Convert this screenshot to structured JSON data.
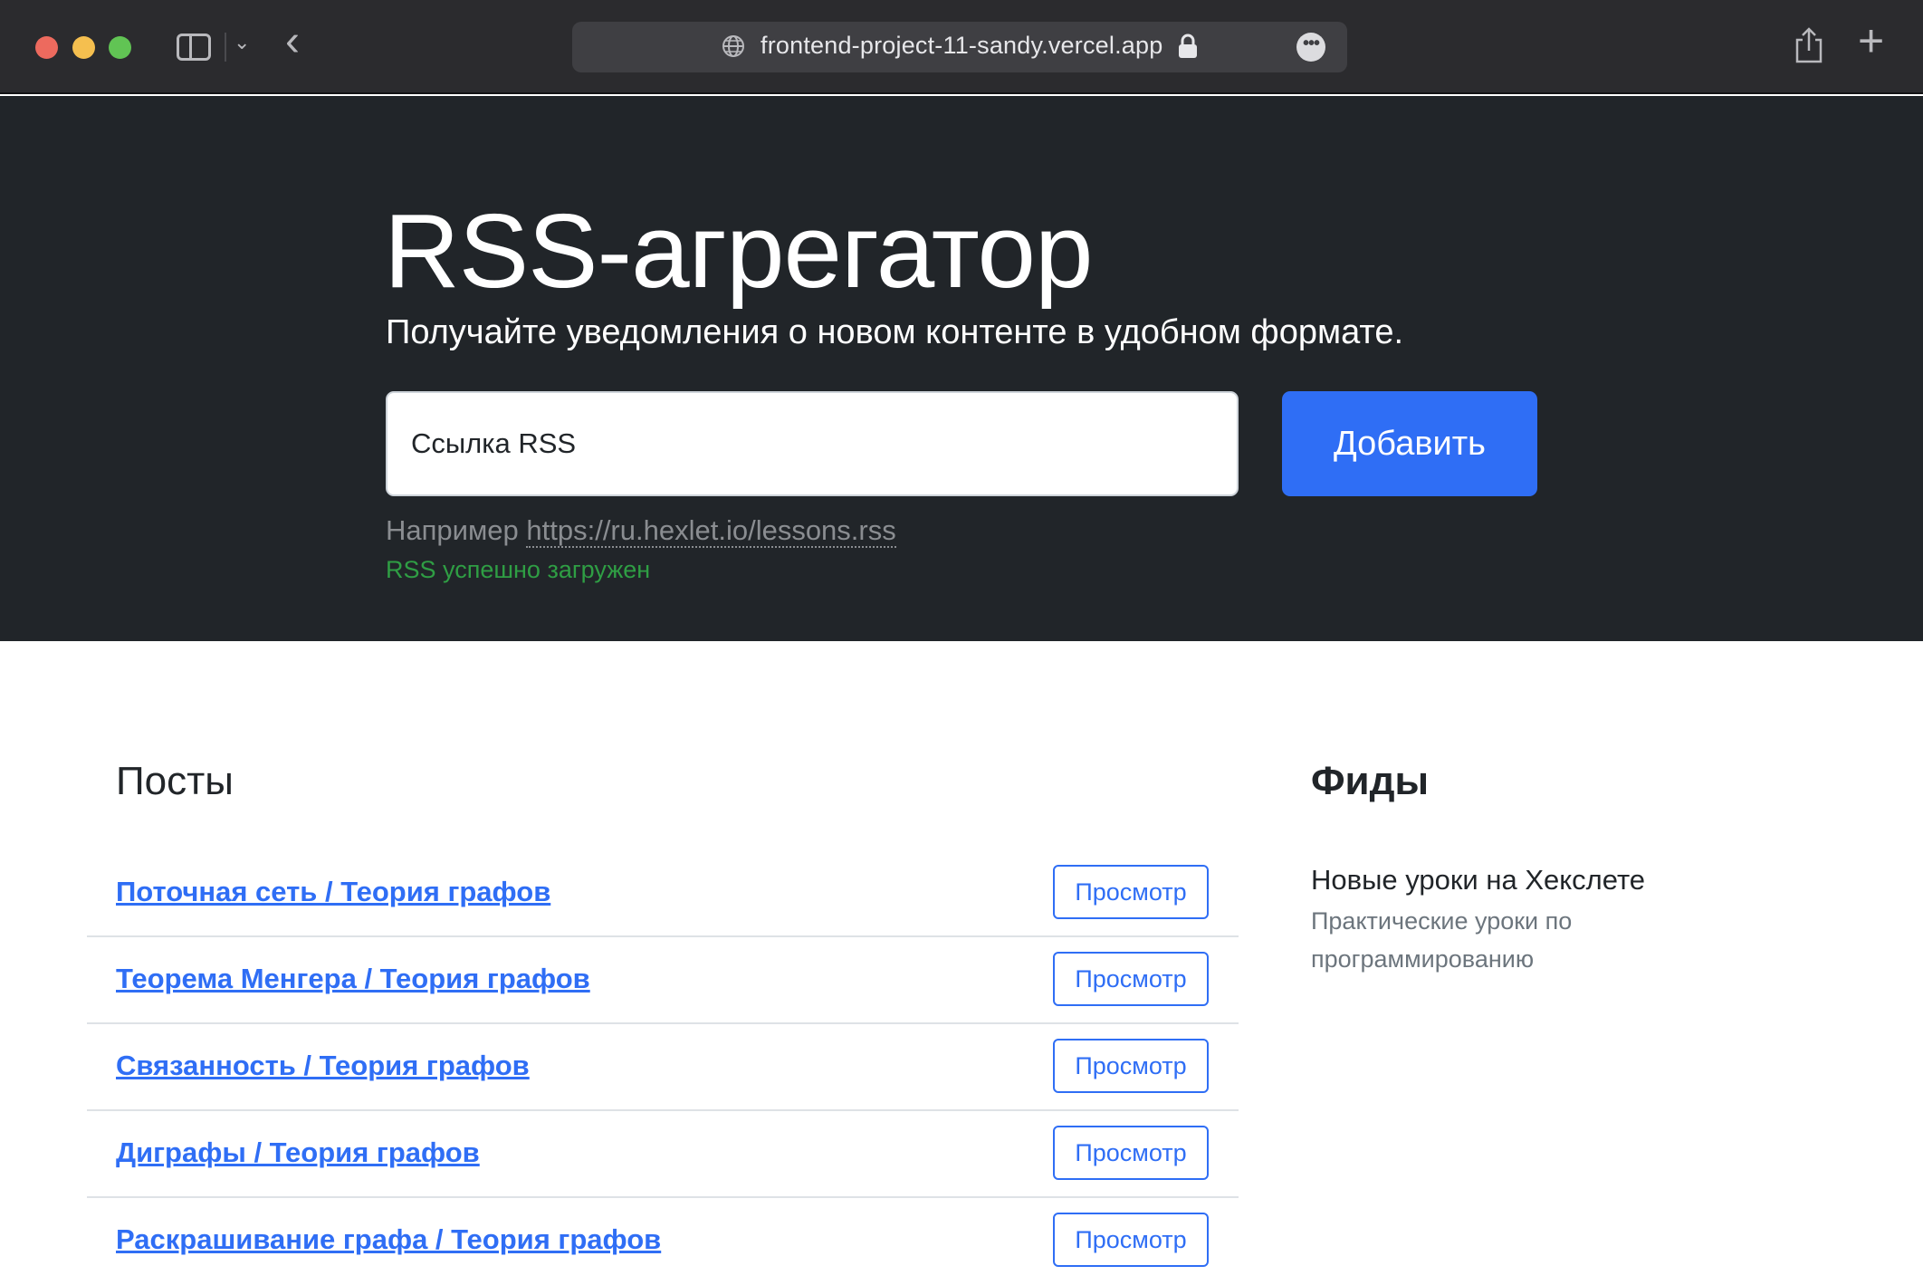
{
  "browser": {
    "url": "frontend-project-11-sandy.vercel.app",
    "icons": [
      "sidebar-icon",
      "chevron-down-icon",
      "back-icon",
      "globe-icon",
      "lock-icon",
      "more-icon",
      "share-icon",
      "plus-icon"
    ]
  },
  "hero": {
    "title": "RSS-агрегатор",
    "lead": "Получайте уведомления о новом контенте в удобном формате.",
    "input_placeholder": "Ссылка RSS",
    "add_label": "Добавить",
    "example_prefix": "Например ",
    "example_link": "https://ru.hexlet.io/lessons.rss",
    "feedback": "RSS успешно загружен"
  },
  "posts": {
    "title": "Посты",
    "items": [
      {
        "title": "Поточная сеть / Теория графов",
        "button": "Просмотр"
      },
      {
        "title": "Теорема Менгера / Теория графов",
        "button": "Просмотр"
      },
      {
        "title": "Связанность / Теория графов",
        "button": "Просмотр"
      },
      {
        "title": "Диграфы / Теория графов",
        "button": "Просмотр"
      },
      {
        "title": "Раскрашивание графа / Теория графов",
        "button": "Просмотр"
      }
    ]
  },
  "feeds": {
    "title": "Фиды",
    "items": [
      {
        "name": "Новые уроки на Хекслете",
        "description": "Практические уроки по программированию"
      }
    ]
  },
  "colors": {
    "primary": "#2f6ef5",
    "hero_bg": "#212529",
    "success": "#2f9e44"
  }
}
